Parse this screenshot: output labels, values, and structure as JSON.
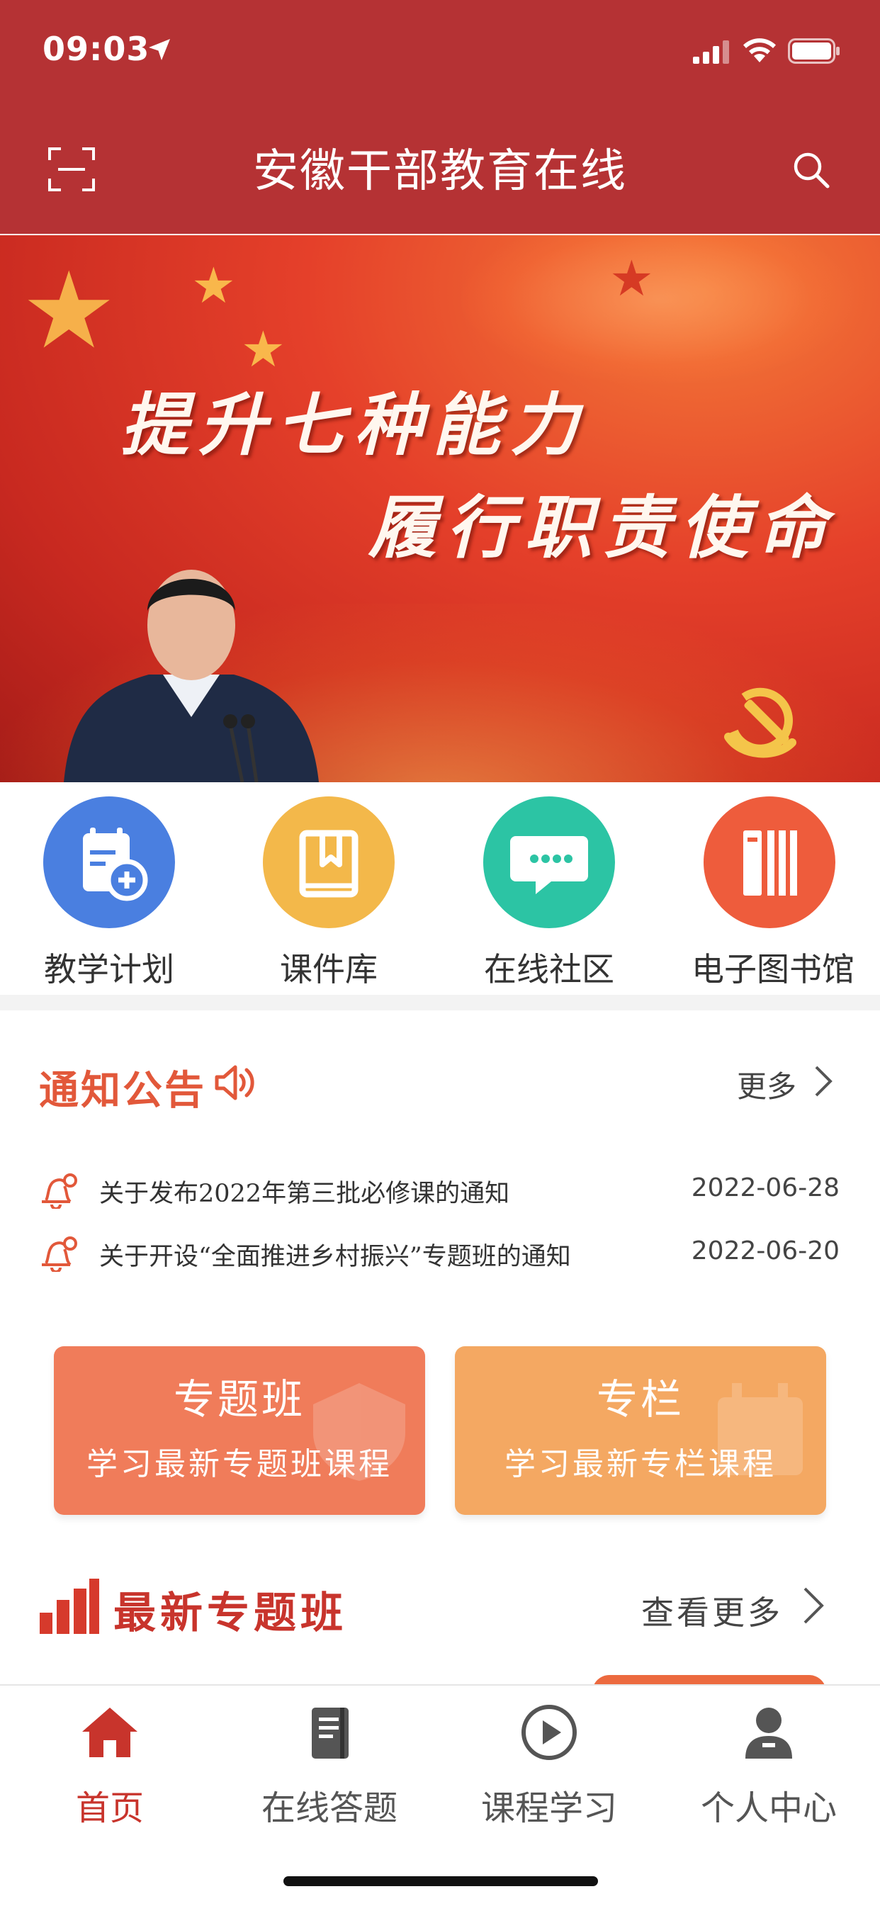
{
  "status_bar": {
    "time": "09:03"
  },
  "header": {
    "title": "安徽干部教育在线"
  },
  "banner": {
    "line1": "提升七种能力",
    "line2": "履行职责使命",
    "slide_count": 12,
    "active_slide": 7
  },
  "quick_menu": [
    {
      "label": "教学计划",
      "icon": "calendar-plus-icon",
      "color": "#4a7fe0"
    },
    {
      "label": "课件库",
      "icon": "book-icon",
      "color": "#f3b84a"
    },
    {
      "label": "在线社区",
      "icon": "chat-icon",
      "color": "#2cc4a4"
    },
    {
      "label": "电子图书馆",
      "icon": "library-icon",
      "color": "#ee5c3c"
    }
  ],
  "notice": {
    "title": "通知公告",
    "more": "更多",
    "items": [
      {
        "text": "关于发布2022年第三批必修课的通知",
        "date": "2022-06-28"
      },
      {
        "text": "关于开设“全面推进乡村振兴”专题班的通知",
        "date": "2022-06-20"
      }
    ]
  },
  "promos": [
    {
      "title": "专题班",
      "subtitle": "学习最新专题班课程",
      "color": "#f07c5a"
    },
    {
      "title": "专栏",
      "subtitle": "学习最新专栏课程",
      "color": "#f4a862"
    }
  ],
  "latest": {
    "title": "最新专题班",
    "more": "查看更多"
  },
  "tabs": [
    {
      "label": "首页",
      "icon": "home-icon",
      "active": true
    },
    {
      "label": "在线答题",
      "icon": "notebook-icon",
      "active": false
    },
    {
      "label": "课程学习",
      "icon": "play-circle-icon",
      "active": false
    },
    {
      "label": "个人中心",
      "icon": "person-icon",
      "active": false
    }
  ],
  "colors": {
    "brand_red": "#b53234",
    "accent_orange": "#e2583a",
    "tab_active": "#c8342c"
  }
}
